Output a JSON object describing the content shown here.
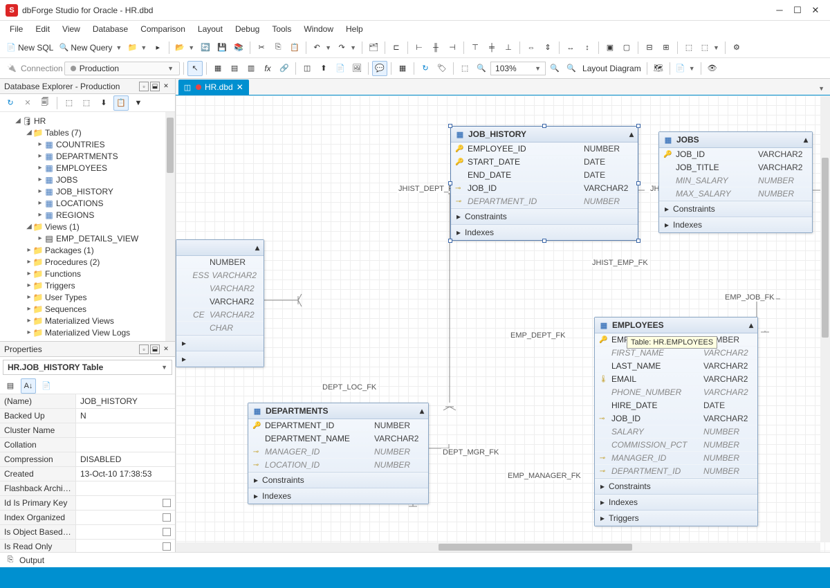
{
  "title": "dbForge Studio for Oracle - HR.dbd",
  "menu": [
    "File",
    "Edit",
    "View",
    "Database",
    "Comparison",
    "Layout",
    "Debug",
    "Tools",
    "Window",
    "Help"
  ],
  "toolbar1": {
    "newSql": "New SQL",
    "newQuery": "New Query"
  },
  "toolbar2": {
    "connection_label": "Connection",
    "connection_value": "Production",
    "zoom": "103%",
    "layout_diagram": "Layout Diagram"
  },
  "explorer": {
    "title": "Database Explorer - Production",
    "root": "HR",
    "tables_label": "Tables (7)",
    "tables": [
      "COUNTRIES",
      "DEPARTMENTS",
      "EMPLOYEES",
      "JOBS",
      "JOB_HISTORY",
      "LOCATIONS",
      "REGIONS"
    ],
    "views_label": "Views (1)",
    "views": [
      "EMP_DETAILS_VIEW"
    ],
    "folders": [
      "Packages (1)",
      "Procedures (2)",
      "Functions",
      "Triggers",
      "User Types",
      "Sequences",
      "Materialized Views",
      "Materialized View Logs"
    ]
  },
  "tab": {
    "name": "HR.dbd"
  },
  "properties": {
    "title": "Properties",
    "combo": "HR.JOB_HISTORY  Table",
    "rows": [
      {
        "n": "(Name)",
        "v": "JOB_HISTORY"
      },
      {
        "n": "Backed Up",
        "v": "N"
      },
      {
        "n": "Cluster Name",
        "v": ""
      },
      {
        "n": "Collation",
        "v": ""
      },
      {
        "n": "Compression",
        "v": "DISABLED"
      },
      {
        "n": "Created",
        "v": "13-Oct-10 17:38:53"
      },
      {
        "n": "Flashback Archiv...",
        "v": ""
      },
      {
        "n": "Id Is Primary Key",
        "v": "",
        "cb": true
      },
      {
        "n": "Index Organized",
        "v": "",
        "cb": true
      },
      {
        "n": "Is Object Based ...",
        "v": "",
        "cb": true
      },
      {
        "n": "Is Read Only",
        "v": "",
        "cb": true
      }
    ]
  },
  "entities": {
    "job_history": {
      "title": "JOB_HISTORY",
      "cols": [
        {
          "ico": "pk",
          "n": "EMPLOYEE_ID",
          "t": "NUMBER"
        },
        {
          "ico": "pk",
          "n": "START_DATE",
          "t": "DATE"
        },
        {
          "ico": "",
          "n": "END_DATE",
          "t": "DATE"
        },
        {
          "ico": "fk",
          "n": "JOB_ID",
          "t": "VARCHAR2"
        },
        {
          "ico": "fk",
          "n": "DEPARTMENT_ID",
          "t": "NUMBER",
          "it": true
        }
      ],
      "secs": [
        "Constraints",
        "Indexes"
      ]
    },
    "jobs": {
      "title": "JOBS",
      "cols": [
        {
          "ico": "pk",
          "n": "JOB_ID",
          "t": "VARCHAR2"
        },
        {
          "ico": "",
          "n": "JOB_TITLE",
          "t": "VARCHAR2"
        },
        {
          "ico": "",
          "n": "MIN_SALARY",
          "t": "NUMBER",
          "it": true
        },
        {
          "ico": "",
          "n": "MAX_SALARY",
          "t": "NUMBER",
          "it": true
        }
      ],
      "secs": [
        "Constraints",
        "Indexes"
      ]
    },
    "departments": {
      "title": "DEPARTMENTS",
      "cols": [
        {
          "ico": "pk",
          "n": "DEPARTMENT_ID",
          "t": "NUMBER"
        },
        {
          "ico": "",
          "n": "DEPARTMENT_NAME",
          "t": "VARCHAR2"
        },
        {
          "ico": "fk",
          "n": "MANAGER_ID",
          "t": "NUMBER",
          "it": true
        },
        {
          "ico": "fk",
          "n": "LOCATION_ID",
          "t": "NUMBER",
          "it": true
        }
      ],
      "secs": [
        "Constraints",
        "Indexes"
      ]
    },
    "employees": {
      "title": "EMPLOYEES",
      "cols": [
        {
          "ico": "pk",
          "n": "EMPLOYEE_ID",
          "t": "NUMBER"
        },
        {
          "ico": "",
          "n": "FIRST_NAME",
          "t": "VARCHAR2",
          "it": true
        },
        {
          "ico": "",
          "n": "LAST_NAME",
          "t": "VARCHAR2"
        },
        {
          "ico": "uq",
          "n": "EMAIL",
          "t": "VARCHAR2"
        },
        {
          "ico": "",
          "n": "PHONE_NUMBER",
          "t": "VARCHAR2",
          "it": true
        },
        {
          "ico": "",
          "n": "HIRE_DATE",
          "t": "DATE"
        },
        {
          "ico": "fk",
          "n": "JOB_ID",
          "t": "VARCHAR2"
        },
        {
          "ico": "",
          "n": "SALARY",
          "t": "NUMBER",
          "it": true
        },
        {
          "ico": "",
          "n": "COMMISSION_PCT",
          "t": "NUMBER",
          "it": true
        },
        {
          "ico": "fk",
          "n": "MANAGER_ID",
          "t": "NUMBER",
          "it": true
        },
        {
          "ico": "fk",
          "n": "DEPARTMENT_ID",
          "t": "NUMBER",
          "it": true
        }
      ],
      "secs": [
        "Constraints",
        "Indexes",
        "Triggers"
      ]
    },
    "partial": {
      "cols": [
        {
          "n": "",
          "t": "NUMBER"
        },
        {
          "n": "ESS",
          "t": "VARCHAR2",
          "it": true
        },
        {
          "n": "",
          "t": "VARCHAR2",
          "it": true
        },
        {
          "n": "",
          "t": "VARCHAR2"
        },
        {
          "n": "CE",
          "t": "VARCHAR2",
          "it": true
        },
        {
          "n": "",
          "t": "CHAR",
          "it": true
        }
      ]
    }
  },
  "relations": {
    "jhist_dept": "JHIST_DEPT_FK",
    "jhist_job": "JHIST_JOB_FK",
    "jhist_emp": "JHIST_EMP_FK",
    "emp_job": "EMP_JOB_FK",
    "emp_dept": "EMP_DEPT_FK",
    "dept_mgr": "DEPT_MGR_FK",
    "emp_manager": "EMP_MANAGER_FK",
    "dept_loc": "DEPT_LOC_FK"
  },
  "tooltip": "Table: HR.EMPLOYEES",
  "status": {
    "output": "Output"
  }
}
